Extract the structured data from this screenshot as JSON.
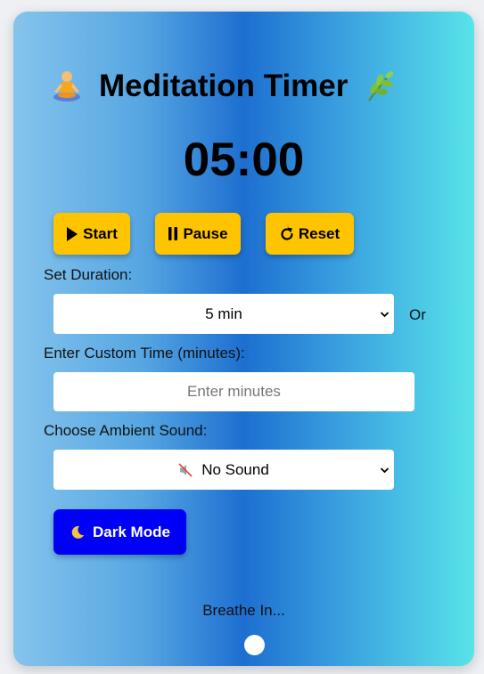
{
  "app": {
    "title": "Meditation Timer",
    "title_left_icon": "person-meditating-icon",
    "title_right_icon": "herb-leaf-icon"
  },
  "timer": {
    "display": "05:00"
  },
  "controls": {
    "start_label": "Start",
    "pause_label": "Pause",
    "reset_label": "Reset",
    "start_icon": "play-icon",
    "pause_icon": "pause-icon",
    "reset_icon": "reset-icon"
  },
  "duration": {
    "label": "Set Duration:",
    "selected": "5 min",
    "or_text": "Or"
  },
  "custom_time": {
    "label": "Enter Custom Time (minutes):",
    "value": "",
    "placeholder": "Enter minutes"
  },
  "sound": {
    "label": "Choose Ambient Sound:",
    "selected": "No Sound",
    "selected_icon": "muted-speaker-icon"
  },
  "dark_mode": {
    "label": "Dark Mode",
    "icon": "crescent-moon-icon"
  },
  "breathing": {
    "text": "Breathe In..."
  },
  "colors": {
    "accent_yellow": "#ffc400",
    "dark_mode_button": "#0000f6",
    "gradient_start": "#85c4ec",
    "gradient_mid": "#1d6fd0",
    "gradient_end": "#58e3e9"
  }
}
